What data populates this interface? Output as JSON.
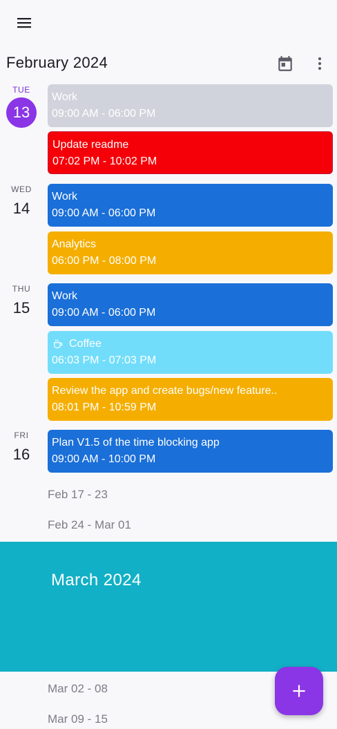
{
  "header": {
    "menu_icon": "hamburger-menu-icon",
    "month_title": "February 2024",
    "calendar_icon": "calendar-today-icon",
    "more_icon": "more-vert-icon"
  },
  "days": [
    {
      "dow": "TUE",
      "dom": "13",
      "today": true
    },
    {
      "dow": "WED",
      "dom": "14"
    },
    {
      "dow": "THU",
      "dom": "15"
    },
    {
      "dow": "FRI",
      "dom": "16"
    }
  ],
  "events": [
    {
      "title": "Work",
      "time": "09:00 AM - 06:00 PM",
      "color": "#d1d3dc"
    },
    {
      "title": "Update readme",
      "time": "07:02 PM - 10:02 PM",
      "color": "#f50008"
    },
    {
      "title": "Work",
      "time": "09:00 AM - 06:00 PM",
      "color": "#1a6fd8"
    },
    {
      "title": "Analytics",
      "time": "06:00 PM - 08:00 PM",
      "color": "#f5ae00"
    },
    {
      "title": "Work",
      "time": "09:00 AM - 06:00 PM",
      "color": "#1a6fd8"
    },
    {
      "title": "Coffee",
      "time": "06:03 PM - 07:03 PM",
      "color": "#72ddfa",
      "icon": "coffee-cup-icon"
    },
    {
      "title": "Review the app and create bugs/new feature..",
      "time": "08:01 PM - 10:59 PM",
      "color": "#f5ae00"
    },
    {
      "title": "Plan V1.5 of the time blocking app",
      "time": "09:00 AM - 10:00 PM",
      "color": "#1a6fd8"
    }
  ],
  "week_ranges": [
    "Feb 17 - 23",
    "Feb 24 - Mar 01",
    "Mar 02 - 08",
    "Mar 09 - 15"
  ],
  "march_banner": {
    "title": "March 2024",
    "color": "#12b0c6"
  },
  "fab": {
    "icon": "plus-icon",
    "color": "#8a35e6"
  },
  "colors": {
    "accent": "#8a35e6",
    "today_text": "#7b2fd6"
  }
}
